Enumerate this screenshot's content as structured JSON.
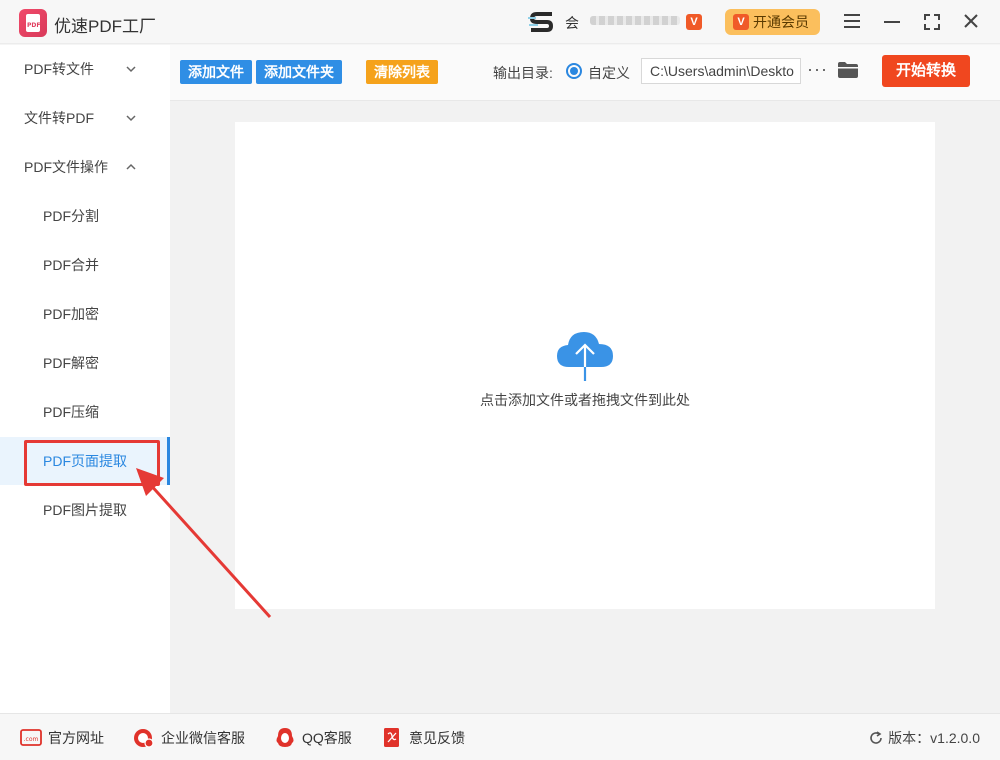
{
  "app": {
    "title": "优速PDF工厂",
    "logo_text": "PDF"
  },
  "header": {
    "user_prefix": "会",
    "vip_badge": "V",
    "vip_button": "开通会员"
  },
  "sidebar": {
    "items": [
      {
        "label": "PDF转文件",
        "type": "group",
        "expanded": false
      },
      {
        "label": "文件转PDF",
        "type": "group",
        "expanded": false
      },
      {
        "label": "PDF文件操作",
        "type": "group",
        "expanded": true
      },
      {
        "label": "PDF分割",
        "type": "sub"
      },
      {
        "label": "PDF合并",
        "type": "sub"
      },
      {
        "label": "PDF加密",
        "type": "sub"
      },
      {
        "label": "PDF解密",
        "type": "sub"
      },
      {
        "label": "PDF压缩",
        "type": "sub"
      },
      {
        "label": "PDF页面提取",
        "type": "sub",
        "active": true
      },
      {
        "label": "PDF图片提取",
        "type": "sub"
      }
    ]
  },
  "toolbar": {
    "add_file": "添加文件",
    "add_folder": "添加文件夹",
    "clear_list": "清除列表",
    "output_label": "输出目录:",
    "custom_option": "自定义",
    "output_path": "C:\\Users\\admin\\Deskto",
    "more": "···",
    "start": "开始转换"
  },
  "main": {
    "drop_hint": "点击添加文件或者拖拽文件到此处"
  },
  "footer": {
    "website": "官方网址",
    "wechat": "企业微信客服",
    "qq": "QQ客服",
    "feedback": "意见反馈",
    "version": "版本：v1.2.0.0"
  },
  "colors": {
    "accent": "#2a87e0",
    "start_button": "#f0471f",
    "clear_button": "#f5a21b",
    "vip_button": "#fbbf5d",
    "annotation_red": "#e53935"
  }
}
